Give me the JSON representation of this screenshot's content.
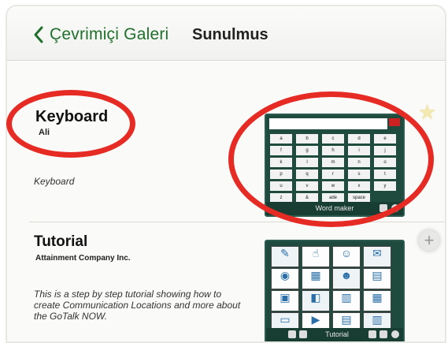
{
  "navbar": {
    "back_label": "Çevrimiçi Galeri",
    "title": "Sunulmus"
  },
  "items": [
    {
      "title": "Keyboard",
      "author": "Ali",
      "description": "Keyboard",
      "thumb_footer": "Word maker",
      "keys": [
        "a",
        "b",
        "c",
        "d",
        "e",
        "f",
        "g",
        "h",
        "i",
        "j",
        "k",
        "l",
        "m",
        "n",
        "o",
        "p",
        "q",
        "r",
        "s",
        "t",
        "u",
        "v",
        "w",
        "x",
        "y",
        "z",
        "&",
        "ade",
        "space"
      ]
    },
    {
      "title": "Tutorial",
      "author": "Attainment Company Inc.",
      "description": "This is a step by step tutorial showing how to create Communication Locations and more about the GoTalk NOW.",
      "thumb_footer": "Tutorial"
    }
  ],
  "colors": {
    "accent": "#1f6f2d",
    "annotation": "#e62a24",
    "thumb_bg": "#1f4a3e"
  }
}
